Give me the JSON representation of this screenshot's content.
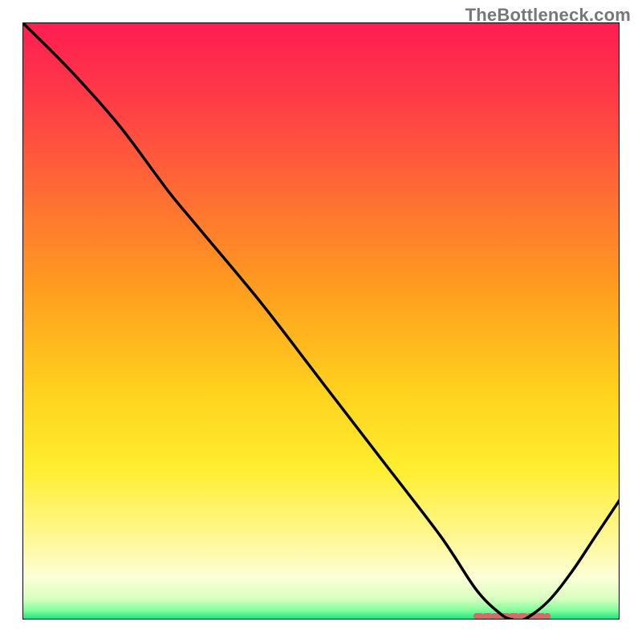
{
  "watermark": "TheBottleneck.com",
  "chart_data": {
    "type": "line",
    "title": "",
    "xlabel": "",
    "ylabel": "",
    "xlim": [
      0,
      100
    ],
    "ylim": [
      0,
      100
    ],
    "series": [
      {
        "name": "bottleneck-curve",
        "x": [
          0,
          8,
          16,
          22,
          25,
          30,
          40,
          50,
          60,
          70,
          76,
          80,
          82,
          84,
          88,
          92,
          96,
          100
        ],
        "values": [
          100,
          92,
          83,
          75,
          71,
          65,
          53,
          40,
          27,
          14,
          5,
          1,
          0,
          0,
          3,
          8,
          14,
          20
        ]
      }
    ],
    "marker": {
      "name": "optimal-range",
      "x_start": 76,
      "x_end": 88,
      "y": 0.6,
      "color": "#d46a6a"
    },
    "gradient_stops": [
      {
        "offset": 0.0,
        "color": "#ff1d52"
      },
      {
        "offset": 0.12,
        "color": "#ff3948"
      },
      {
        "offset": 0.28,
        "color": "#ff6a34"
      },
      {
        "offset": 0.45,
        "color": "#ff9e1e"
      },
      {
        "offset": 0.62,
        "color": "#ffd21e"
      },
      {
        "offset": 0.75,
        "color": "#ffee30"
      },
      {
        "offset": 0.87,
        "color": "#fff89a"
      },
      {
        "offset": 0.93,
        "color": "#fcffd6"
      },
      {
        "offset": 0.965,
        "color": "#d8ffc0"
      },
      {
        "offset": 0.985,
        "color": "#7fff9a"
      },
      {
        "offset": 1.0,
        "color": "#18e07e"
      }
    ]
  }
}
